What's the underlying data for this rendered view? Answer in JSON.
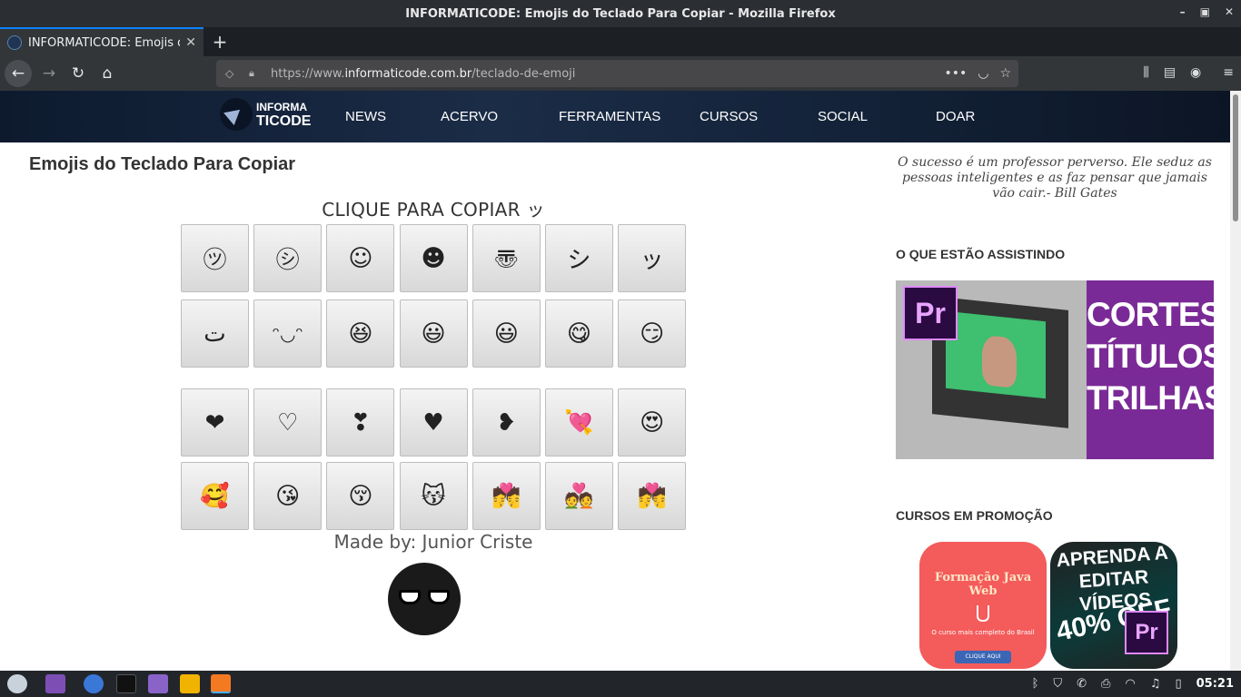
{
  "window": {
    "title": "INFORMATICODE: Emojis do Teclado Para Copiar - Mozilla Firefox",
    "controls": [
      "–",
      "▣",
      "✕"
    ]
  },
  "browser": {
    "tab_title": "INFORMATICODE: Emojis do Teclado Para Copiar",
    "new_tab": "+",
    "url_prefix": "https://www.",
    "url_host": "informaticode.com.br",
    "url_path": "/teclado-de-emoji",
    "url_page_actions": "•••"
  },
  "site": {
    "logo_line1": "INFORMA",
    "logo_line2": "TICODE",
    "nav": [
      "NEWS",
      "ACERVO",
      "FERRAMENTAS",
      "CURSOS",
      "SOCIAL",
      "DOAR"
    ]
  },
  "main": {
    "page_title": "Emojis do Teclado Para Copiar",
    "copy_heading": "CLIQUE PARA COPIAR ッ",
    "rows": [
      [
        "㋡",
        "㋛",
        "☺",
        "☻",
        "〠",
        "シ",
        "ッ"
      ],
      [
        "ت",
        "ᵔ◡ᵔ",
        "😆",
        "😃",
        "😃",
        "😋",
        "😏"
      ],
      [
        "❤",
        "♡",
        "❣",
        "♥",
        "❥",
        "💘",
        "😍"
      ],
      [
        "🥰",
        "😘",
        "😚",
        "😽",
        "💏",
        "💑",
        "💏"
      ]
    ],
    "made_by": "Made by: Junior Criste"
  },
  "sidebar": {
    "quote": "O sucesso é um professor perverso. Ele seduz as pessoas inteligentes e as faz pensar que jamais vão cair.- Bill Gates",
    "watching_title": "O QUE ESTÃO ASSISTINDO",
    "watching_promo": [
      "CORTES",
      "TÍTULOS",
      "TRILHAS"
    ],
    "watching_badge": "Pr",
    "courses_title": "CURSOS EM PROMOÇÃO",
    "java_course": {
      "title": "Formação Java Web",
      "subtitle": "O curso mais completo do Brasil",
      "button": "CLIQUE AQUI"
    },
    "video_course": {
      "title": "APRENDA A EDITAR VÍDEOS",
      "discount": "40% OFF",
      "badge": "Pr"
    }
  },
  "taskbar": {
    "clock": "05:21"
  },
  "colors": {
    "tab_accent": "#0a84ff",
    "header_bg": "#1b2c47",
    "promo_purple": "#7a2a96",
    "java_red": "#f45b5b"
  }
}
